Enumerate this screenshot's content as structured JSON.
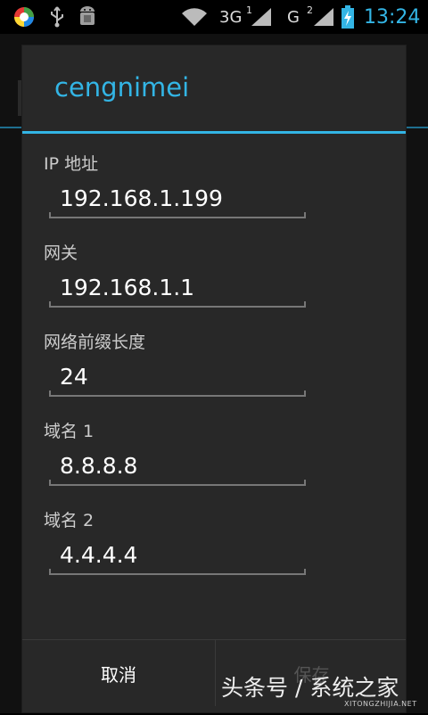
{
  "status_bar": {
    "network_3g_label": "3G",
    "sim1_index": "1",
    "network_g_label": "G",
    "sim2_index": "2",
    "time": "13:24"
  },
  "dialog": {
    "title": "cengnimei",
    "fields": [
      {
        "label": "IP 地址",
        "value": "192.168.1.199"
      },
      {
        "label": "网关",
        "value": "192.168.1.1"
      },
      {
        "label": "网络前缀长度",
        "value": "24"
      },
      {
        "label": "域名 1",
        "value": "8.8.8.8"
      },
      {
        "label": "域名 2",
        "value": "4.4.4.4"
      }
    ],
    "cancel_label": "取消",
    "save_label": "保存"
  },
  "watermark": {
    "text": "头条号 / 系统之家",
    "subtext": "XITONGZHIJIA.NET"
  },
  "colors": {
    "accent": "#33b5e5",
    "dialog_bg": "#282828",
    "background": "#000000"
  },
  "icons": [
    "app-logo-icon",
    "usb-icon",
    "android-debug-icon",
    "wifi-icon",
    "signal-icon",
    "battery-charging-icon"
  ]
}
